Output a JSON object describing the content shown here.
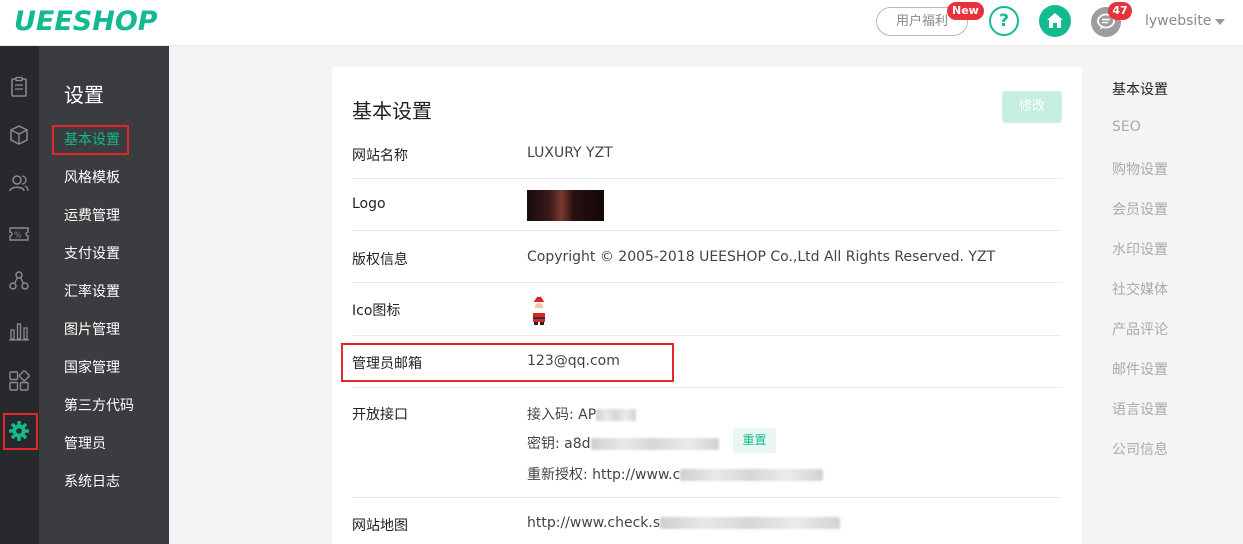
{
  "header": {
    "logo_text": "UEESHOP",
    "welfare_label": "用户福利",
    "new_badge": "New",
    "help_label": "?",
    "message_count": "47",
    "user_name": "lywebsite",
    "brand_color": "#13b98f",
    "badge_color": "#e6323c"
  },
  "rail": {
    "icons": [
      "orders-icon",
      "products-icon",
      "users-icon",
      "coupon-icon",
      "share-icon",
      "stats-icon",
      "apps-icon",
      "settings-gear-icon"
    ]
  },
  "submenu": {
    "title": "设置",
    "items": [
      "基本设置",
      "风格模板",
      "运费管理",
      "支付设置",
      "汇率设置",
      "图片管理",
      "国家管理",
      "第三方代码",
      "管理员",
      "系统日志"
    ]
  },
  "panel": {
    "title": "基本设置",
    "edit_label": "修改",
    "rows": {
      "site_name": {
        "label": "网站名称",
        "value": "LUXURY YZT"
      },
      "logo": {
        "label": "Logo"
      },
      "copyright": {
        "label": "版权信息",
        "value": "Copyright © 2005-2018 UEESHOP Co.,Ltd All Rights Reserved. YZT"
      },
      "ico": {
        "label": "Ico图标"
      },
      "admin_email": {
        "label": "管理员邮箱",
        "value": "123@qq.com"
      },
      "api": {
        "label": "开放接口",
        "access_code_label": "接入码: AP",
        "secret_label": "密钥: a8d",
        "reauth_label": "重新授权: http://www.c",
        "reset_label": "重置"
      },
      "sitemap": {
        "label": "网站地图",
        "value": "http://www.check.s"
      }
    }
  },
  "right_nav": {
    "items": [
      "基本设置",
      "SEO",
      "购物设置",
      "会员设置",
      "水印设置",
      "社交媒体",
      "产品评论",
      "邮件设置",
      "语言设置",
      "公司信息"
    ]
  }
}
